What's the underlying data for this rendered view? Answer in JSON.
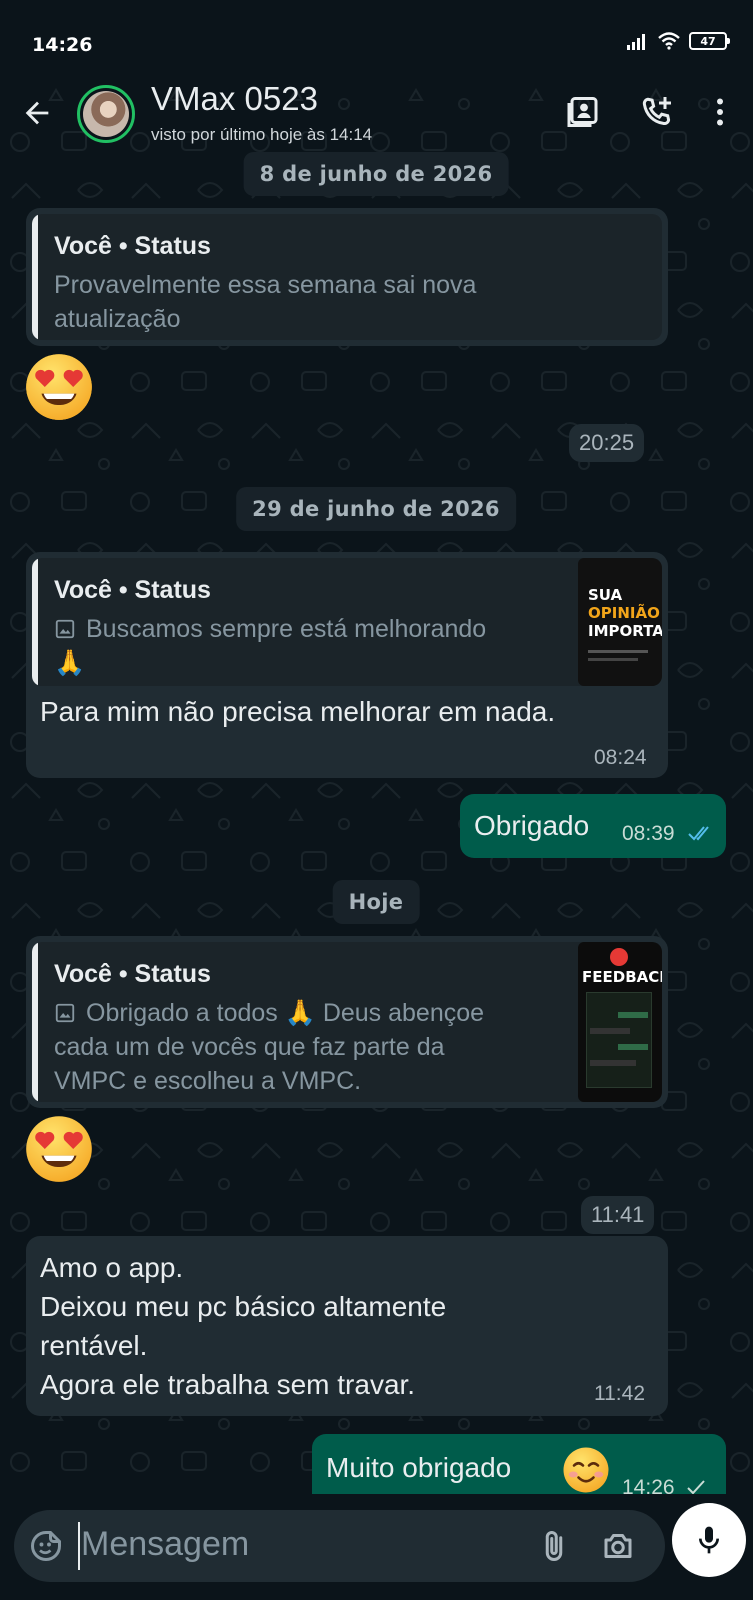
{
  "status_bar": {
    "time": "14:26",
    "battery": "47",
    "icons": [
      "signal-icon",
      "wifi-icon",
      "battery-icon"
    ]
  },
  "header": {
    "contact_name": "VMax 0523",
    "last_seen": "visto por último hoje às 14:14",
    "icons": [
      "back-arrow-icon",
      "contact-card-icon",
      "add-call-icon",
      "more-vert-icon"
    ]
  },
  "chat": {
    "date_1": "8 de junho de 2026",
    "msg_1": {
      "quote_title": "Você • Status",
      "quote_line_1": "Provavelmente essa semana sai nova",
      "quote_line_2": "atualização",
      "emoji": "smiling-face-with-heart-eyes",
      "time": "20:25"
    },
    "date_2": "29 de junho de 2026",
    "msg_2": {
      "quote_title": "Você • Status",
      "quote_line_1": "Buscamos sempre está melhorando",
      "quote_line_2": "🙏",
      "thumb_text_1": "SUA",
      "thumb_text_2": "OPINIÃO",
      "thumb_text_3": "IMPORTA.",
      "text": "Para mim não precisa melhorar em nada.",
      "time": "08:24"
    },
    "msg_3": {
      "text": "Obrigado",
      "time": "08:39",
      "status": "read"
    },
    "date_3": "Hoje",
    "msg_4": {
      "quote_title": "Você • Status",
      "quote_line_1": "Obrigado a todos 🙏 Deus abençoe",
      "quote_line_2": "cada um de vocês que faz parte da",
      "quote_line_3": "VMPC e escolheu a VMPC.",
      "thumb_text": "FEEDBACKS",
      "emoji": "smiling-face-with-heart-eyes",
      "time": "11:41"
    },
    "msg_5": {
      "text": "Amo o app.\nDeixou meu pc básico altamente\nrentável.\nAgora ele trabalha sem travar.",
      "time": "11:42"
    },
    "msg_6": {
      "text": "Muito obrigado",
      "emoji": "smiling-face-icon",
      "time": "14:26",
      "status": "sent"
    }
  },
  "composer": {
    "placeholder": "Mensagem",
    "icons": [
      "sticker-icon",
      "attach-icon",
      "camera-icon",
      "mic-icon"
    ]
  },
  "colors": {
    "background": "#0b141a",
    "incoming_bubble": "#202c33",
    "outgoing_bubble": "#005c4b",
    "accent": "#21c063",
    "read_tick": "#53bdeb"
  }
}
